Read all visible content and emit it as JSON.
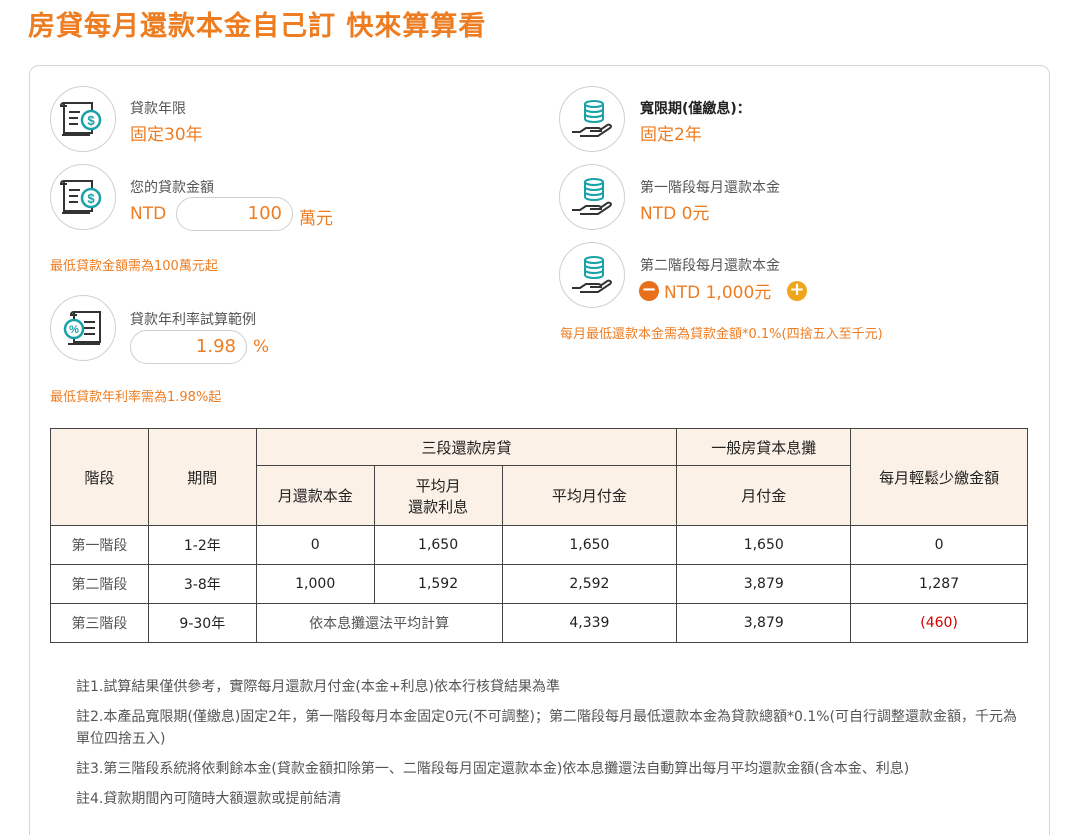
{
  "page_title": "房貸每月還款本金自己訂 快來算算看",
  "left": {
    "loan_term": {
      "label": "貸款年限",
      "value": "固定30年"
    },
    "loan_amount": {
      "label": "您的貸款金額",
      "prefix": "NTD",
      "value": "100",
      "suffix": "萬元",
      "note": "最低貸款金額需為100萬元起"
    },
    "interest_rate": {
      "label": "貸款年利率試算範例",
      "value": "1.98",
      "suffix": "%",
      "note": "最低貸款年利率需為1.98%起"
    }
  },
  "right": {
    "grace_period": {
      "label": "寬限期(僅繳息)：",
      "value": "固定2年"
    },
    "stage1": {
      "label": "第一階段每月還款本金",
      "value": "NTD 0元"
    },
    "stage2": {
      "label": "第二階段每月還款本金",
      "value": "NTD 1,000元",
      "minus": "−",
      "plus": "+",
      "note": "每月最低還款本金需為貸款金額*0.1%(四捨五入至千元)"
    }
  },
  "table": {
    "headers": {
      "stage": "階段",
      "period": "期間",
      "three_stage_group": "三段還款房貸",
      "general_group": "一般房貸本息攤",
      "savings": "每月輕鬆少繳金額",
      "monthly_principal": "月還款本金",
      "avg_interest_line1": "平均月",
      "avg_interest_line2": "還款利息",
      "avg_payment": "平均月付金",
      "monthly_payment": "月付金"
    },
    "rows": [
      {
        "stage": "第一階段",
        "period": "1-2年",
        "principal": "0",
        "interest": "1,650",
        "avg_payment": "1,650",
        "general_payment": "1,650",
        "savings": "0"
      },
      {
        "stage": "第二階段",
        "period": "3-8年",
        "principal": "1,000",
        "interest": "1,592",
        "avg_payment": "2,592",
        "general_payment": "3,879",
        "savings": "1,287"
      },
      {
        "stage": "第三階段",
        "period": "9-30年",
        "merged_text": "依本息攤還法平均計算",
        "avg_payment": "4,339",
        "general_payment": "3,879",
        "savings": "(460)"
      }
    ]
  },
  "footnotes": [
    "註1.試算結果僅供參考，實際每月還款月付金(本金+利息)依本行核貸結果為準",
    "註2.本產品寬限期(僅繳息)固定2年，第一階段每月本金固定0元(不可調整)；第二階段每月最低還款本金為貸款總額*0.1%(可自行調整還款金額，千元為單位四捨五入)",
    "註3.第三階段系統將依剩餘本金(貸款金額扣除第一、二階段每月固定還款本金)依本息攤還法自動算出每月平均還款金額(含本金、利息)",
    "註4.貸款期間內可隨時大額還款或提前結清"
  ],
  "colors": {
    "accent": "#ee7d22",
    "table_header_bg": "#fbf1e6",
    "negative": "#d40000",
    "icon_teal": "#19a1a8"
  },
  "icons": [
    "bill-dollar-icon",
    "bill-dollar-icon",
    "bill-percent-icon",
    "coins-hand-icon",
    "coins-hand-icon",
    "coins-hand-icon",
    "minus-circle-icon",
    "plus-circle-icon"
  ]
}
